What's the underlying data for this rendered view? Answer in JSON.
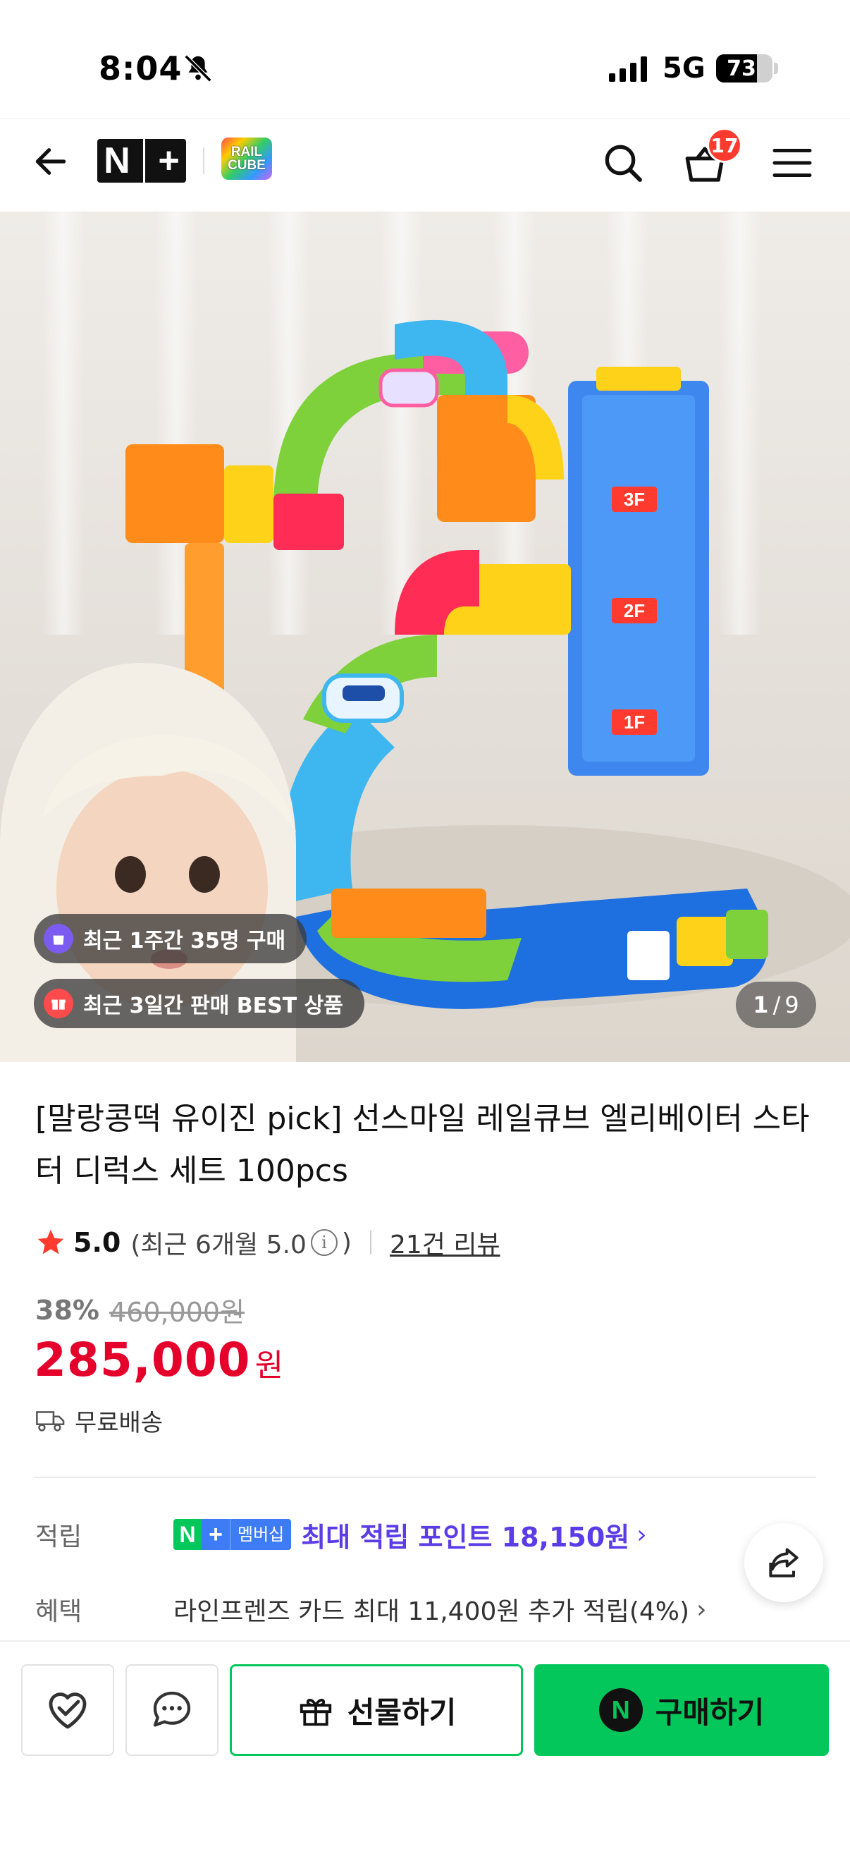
{
  "status": {
    "time": "8:04",
    "network": "5G",
    "battery": "73",
    "battery_level": 0.73
  },
  "nav": {
    "logo_text": "N+",
    "brand_logo_text": "RAIL CUBE",
    "cart_count": "17"
  },
  "image": {
    "badge_recent_buyers": "최근 1주간 35명 구매",
    "badge_best": "최근 3일간 판매 BEST 상품",
    "counter_current": "1",
    "counter_sep": "/",
    "counter_total": "9",
    "toy_floor_labels": [
      "3F",
      "2F",
      "1F"
    ]
  },
  "product": {
    "title": "[말랑콩떡 유이진 pick] 선스마일 레일큐브 엘리베이터 스타터 디럭스 세트 100pcs",
    "rating": "5.0",
    "recent_rating": "(최근 6개월 5.0",
    "recent_rating_close": ")",
    "review_count": "21건 리뷰",
    "discount_pct": "38%",
    "original_price": "460,000원",
    "price": "285,000",
    "price_unit": "원",
    "shipping": "무료배송"
  },
  "benefits": {
    "points_label": "적립",
    "member_badge": "멤버십",
    "max_points": "최대 적립 포인트 18,150원",
    "benefit_label": "혜택",
    "card_benefit": "라인프렌즈 카드 최대 11,400원 추가 적립(4%)"
  },
  "actions": {
    "gift_label": "선물하기",
    "buy_label": "구매하기",
    "npay_letter": "N"
  },
  "colors": {
    "brand_green": "#03c75a",
    "price_red": "#e4002b",
    "points_purple": "#5b3ce6",
    "badge_red": "#ff3b30"
  }
}
